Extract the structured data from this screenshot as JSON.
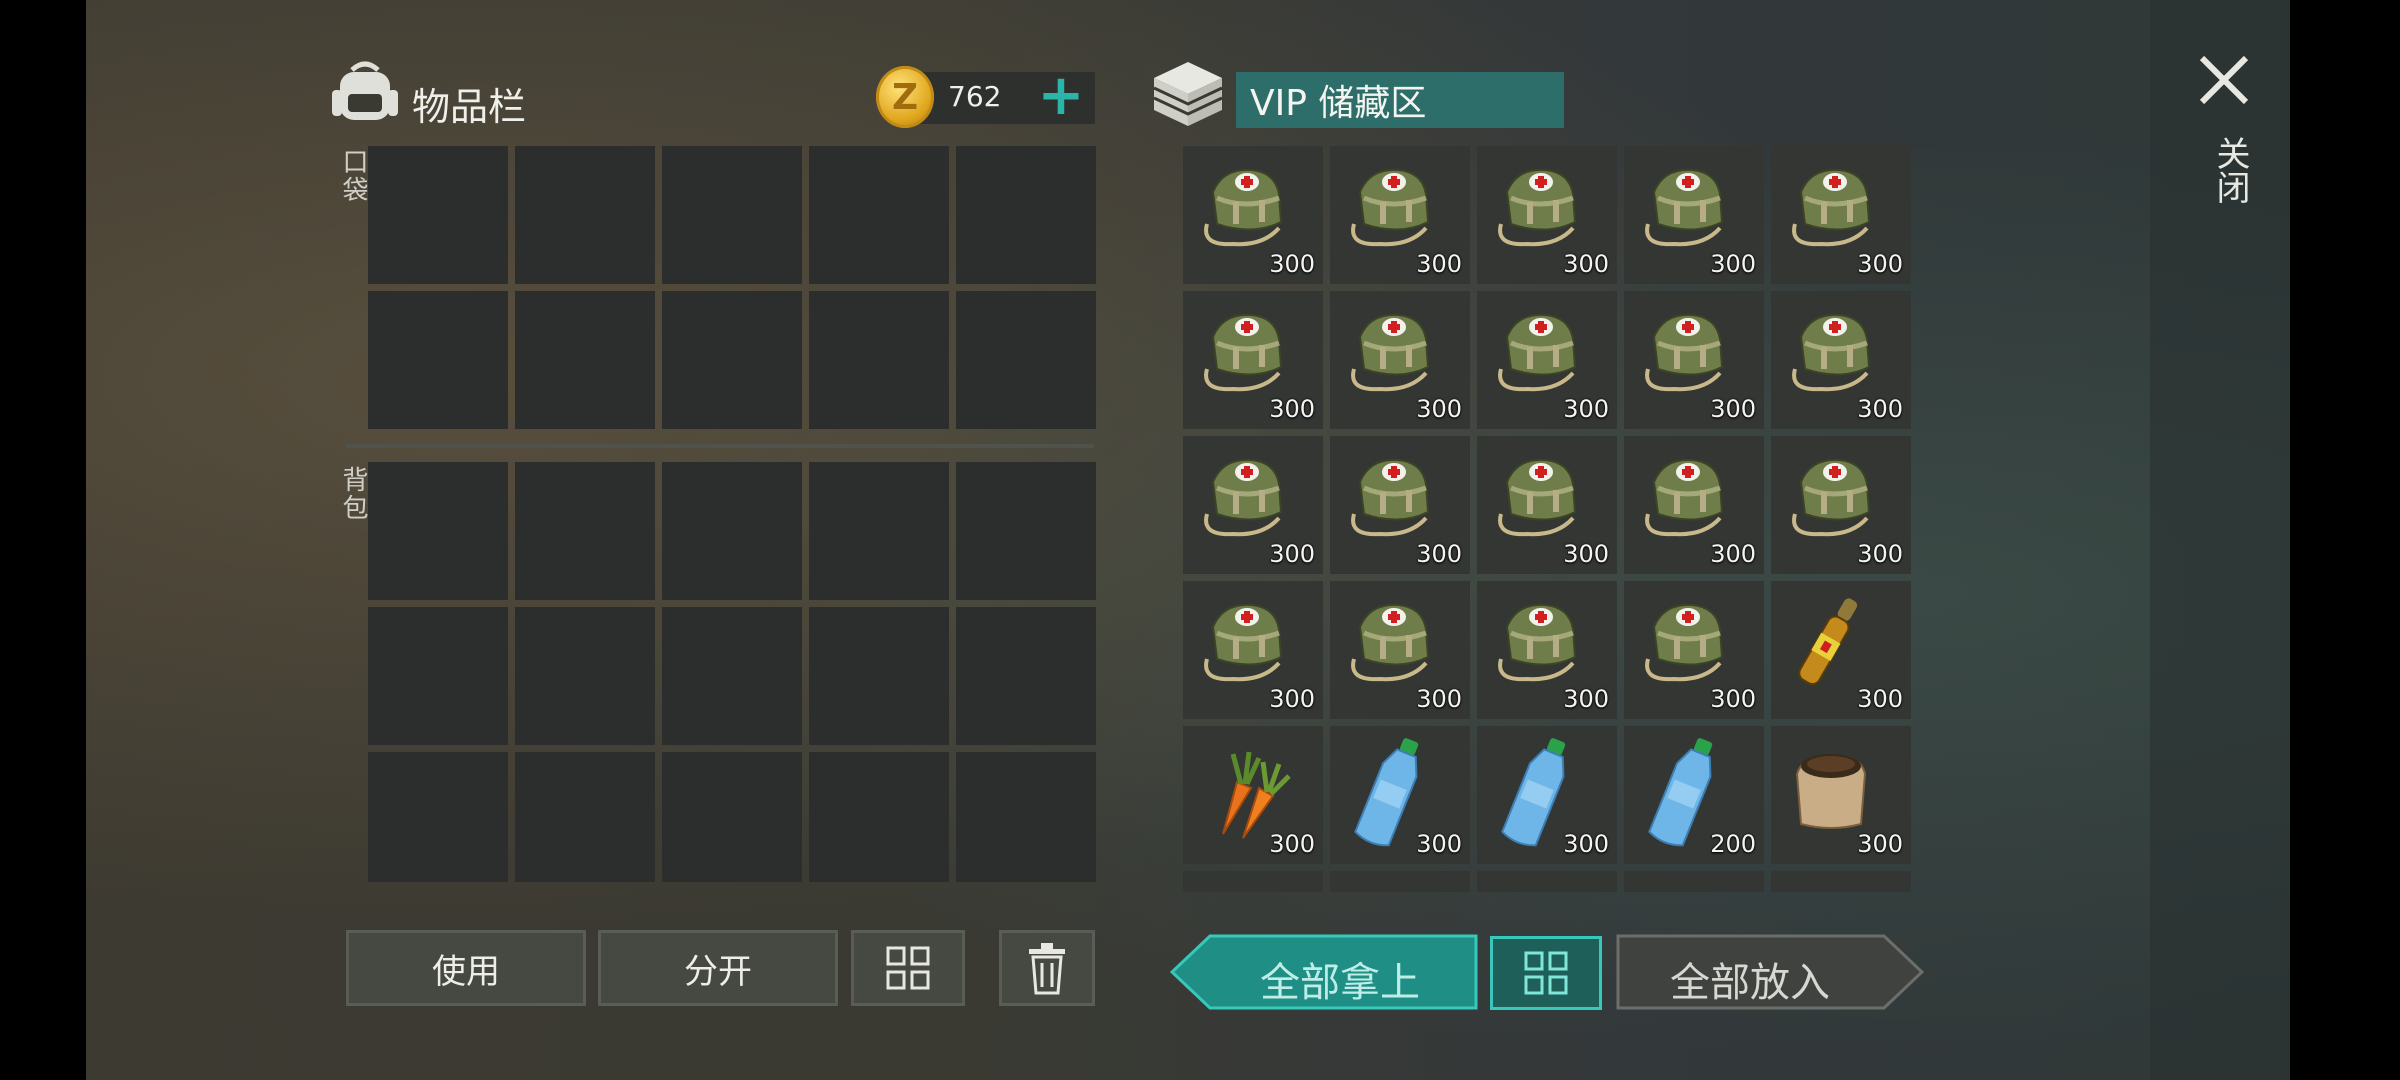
{
  "inventory": {
    "title": "物品栏",
    "icon": "backpack-icon",
    "coins": "762",
    "coin_icon": "z-coin-icon",
    "pocket_label": "口袋",
    "backpack_label": "背包"
  },
  "storage": {
    "icon": "storage-crate-icon",
    "name": "VIP 储藏区",
    "items": [
      {
        "icon": "medkit-bag-icon",
        "qty": "300"
      },
      {
        "icon": "medkit-bag-icon",
        "qty": "300"
      },
      {
        "icon": "medkit-bag-icon",
        "qty": "300"
      },
      {
        "icon": "medkit-bag-icon",
        "qty": "300"
      },
      {
        "icon": "medkit-bag-icon",
        "qty": "300"
      },
      {
        "icon": "medkit-bag-icon",
        "qty": "300"
      },
      {
        "icon": "medkit-bag-icon",
        "qty": "300"
      },
      {
        "icon": "medkit-bag-icon",
        "qty": "300"
      },
      {
        "icon": "medkit-bag-icon",
        "qty": "300"
      },
      {
        "icon": "medkit-bag-icon",
        "qty": "300"
      },
      {
        "icon": "medkit-bag-icon",
        "qty": "300"
      },
      {
        "icon": "medkit-bag-icon",
        "qty": "300"
      },
      {
        "icon": "medkit-bag-icon",
        "qty": "300"
      },
      {
        "icon": "medkit-bag-icon",
        "qty": "300"
      },
      {
        "icon": "medkit-bag-icon",
        "qty": "300"
      },
      {
        "icon": "medkit-bag-icon",
        "qty": "300"
      },
      {
        "icon": "medkit-bag-icon",
        "qty": "300"
      },
      {
        "icon": "medkit-bag-icon",
        "qty": "300"
      },
      {
        "icon": "medkit-bag-icon",
        "qty": "300"
      },
      {
        "icon": "ampoule-icon",
        "qty": "300"
      },
      {
        "icon": "carrot-icon",
        "qty": "300"
      },
      {
        "icon": "water-bottle-icon",
        "qty": "300"
      },
      {
        "icon": "water-bottle-icon",
        "qty": "300"
      },
      {
        "icon": "water-bottle-icon",
        "qty": "200"
      },
      {
        "icon": "soil-sack-icon",
        "qty": "300"
      }
    ]
  },
  "buttons": {
    "use": "使用",
    "split": "分开",
    "sort_icon": "sort-grid-icon",
    "trash_icon": "trash-icon",
    "take_all": "全部拿上",
    "put_all": "全部放入"
  },
  "close": {
    "icon": "close-icon",
    "label": "关闭"
  },
  "colors": {
    "accent": "#2bb5a8",
    "vip_field": "#2e6e6a",
    "coin_gold": "#e0a71e"
  }
}
